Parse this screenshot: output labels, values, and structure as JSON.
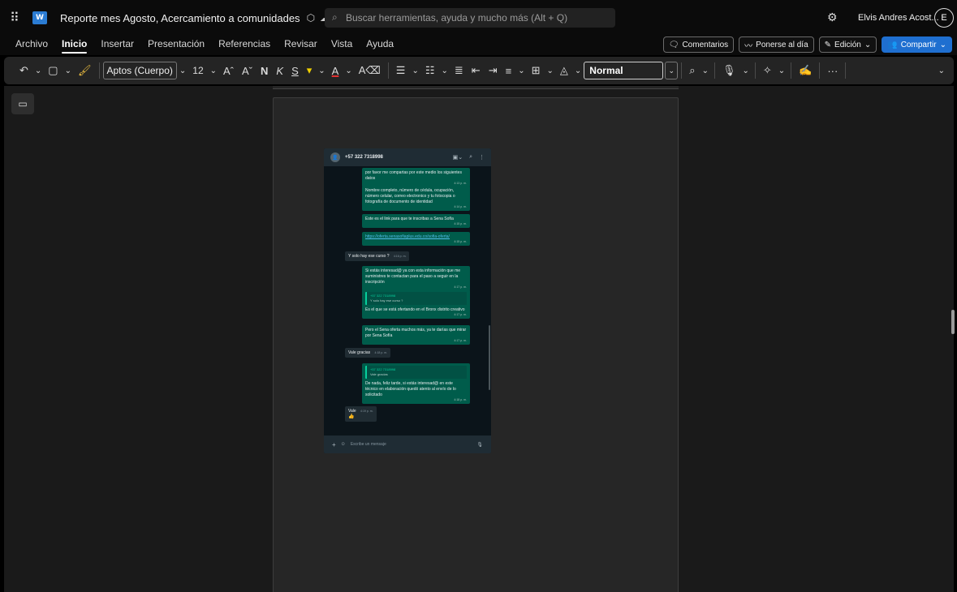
{
  "titlebar": {
    "app_letter": "W",
    "doc_title": "Reporte mes Agosto, Acercamiento a comunidades",
    "search_placeholder": "Buscar herramientas, ayuda y mucho más (Alt + Q)",
    "user_name": "Elvis Andres Acost...",
    "avatar_initial": "E"
  },
  "tabs": [
    "Archivo",
    "Inicio",
    "Insertar",
    "Presentación",
    "Referencias",
    "Revisar",
    "Vista",
    "Ayuda"
  ],
  "tab_actions": {
    "comments": "Comentarios",
    "catch_up": "Ponerse al día",
    "editing": "Edición",
    "share": "Compartir"
  },
  "toolbar": {
    "font_name": "Aptos (Cuerpo)",
    "font_size": "12",
    "bold": "N",
    "italic": "K",
    "underline": "S",
    "style": "Normal"
  },
  "chat": {
    "contact": "+57 322 7318998",
    "messages": {
      "m1_text": "por favor me compartas por este medio los siguientes datos",
      "m1_time": "4:13 p. m.",
      "m2_text": "Nombre completo, número de cédula, ocupación, número celular, correo electronico y tu fotocopia o fotografía de documento de identidad",
      "m2_time": "4:14 p. m.",
      "m3_text": "Este es el link para que te inscribas a Sena Sofía",
      "m3_time": "4:15 p. m.",
      "m4_text": "https://oferta.senasofiaplus.edu.co/sofia-oferta/",
      "m4_time": "4:15 p. m.",
      "m5_text": "Y solo hay ese curso ?",
      "m5_time": "4:16 p. m.",
      "m6_text": "Si estás interesad@ ya con esta información que me suministres te contactan para el paso a seguir en la inscripción",
      "m6_time": "4:17 p. m.",
      "m7_quote_name": "+57 322 7318998",
      "m7_quote_text": "Y solo hay ese curso ?",
      "m7_text": "Es el que se está ofertando en el Bronx distrito creativo",
      "m7_time": "4:17 p. m.",
      "m8_text": "Pero el Sena oferta muchos más, ya te darías que mirar por Sena Sofía",
      "m8_time": "4:17 p. m.",
      "m9_text": "Vale gracias",
      "m9_time": "4:18 p. m.",
      "m10_quote_name": "+57 322 7318998",
      "m10_quote_text": "Vale gracias",
      "m10_text": "De nada, feliz tarde, si estás interesad@ en este técnico en elaboración quedó atento al envío de lo solicitado",
      "m10_time": "4:18 p. m.",
      "m11_text": "Vale",
      "m11_time": "4:19 p. m.",
      "m11_emoji": "👍"
    },
    "input_placeholder": "Escribe un mensaje"
  }
}
